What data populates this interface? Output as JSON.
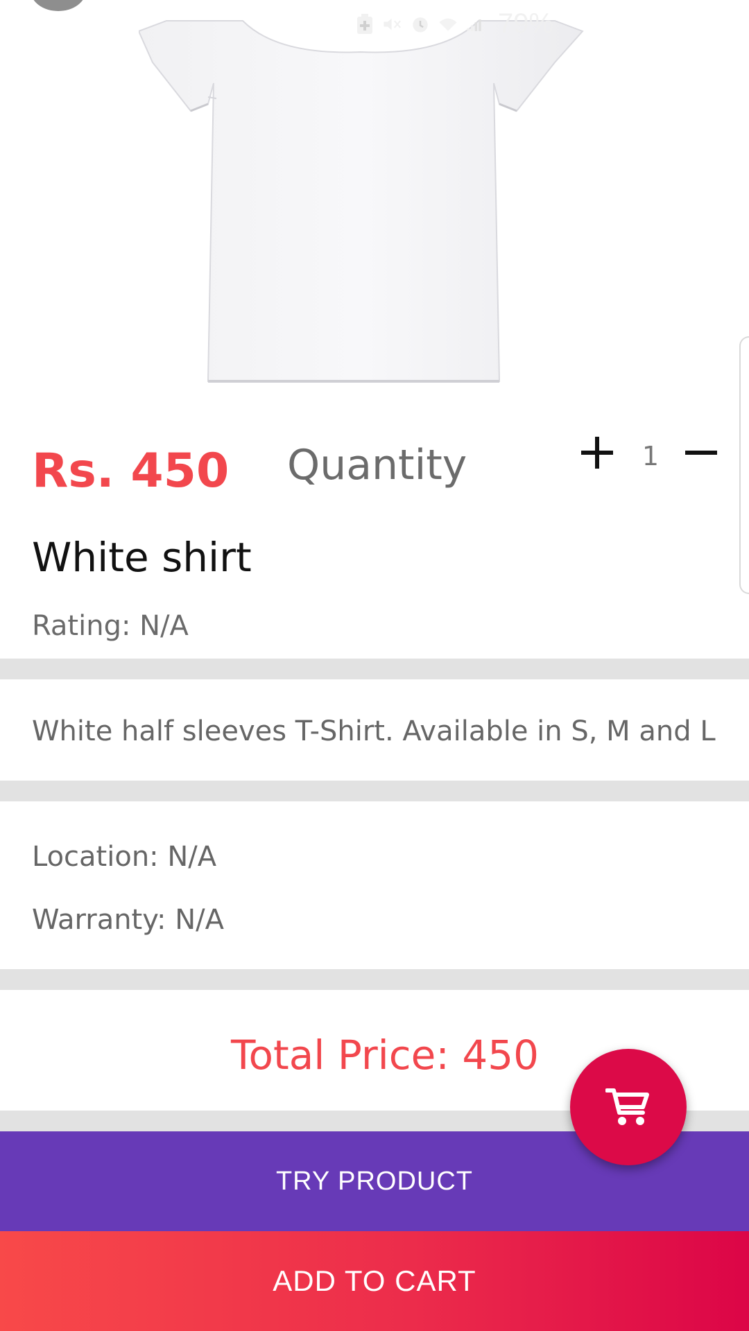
{
  "status_bar": {
    "battery_percent": "79%",
    "icons": [
      "battery-saver-icon",
      "mute-icon",
      "alarm-icon",
      "wifi-icon",
      "signal-icon"
    ]
  },
  "product": {
    "image": "white-tshirt",
    "price": "Rs. 450",
    "quantity_label": "Quantity",
    "quantity_value": "1",
    "name": "White shirt",
    "rating": "Rating: N/A",
    "description": "White half sleeves T-Shirt. Available in S, M and L",
    "location": "Location: N/A",
    "warranty": "Warranty: N/A",
    "total_price": "Total Price: 450"
  },
  "actions": {
    "try_label": "TRY PRODUCT",
    "add_to_cart_label": "ADD TO CART",
    "fab_icon": "cart-icon"
  },
  "colors": {
    "accent_red": "#f2474d",
    "purple": "#673ab7",
    "fab": "#dc0a48"
  }
}
